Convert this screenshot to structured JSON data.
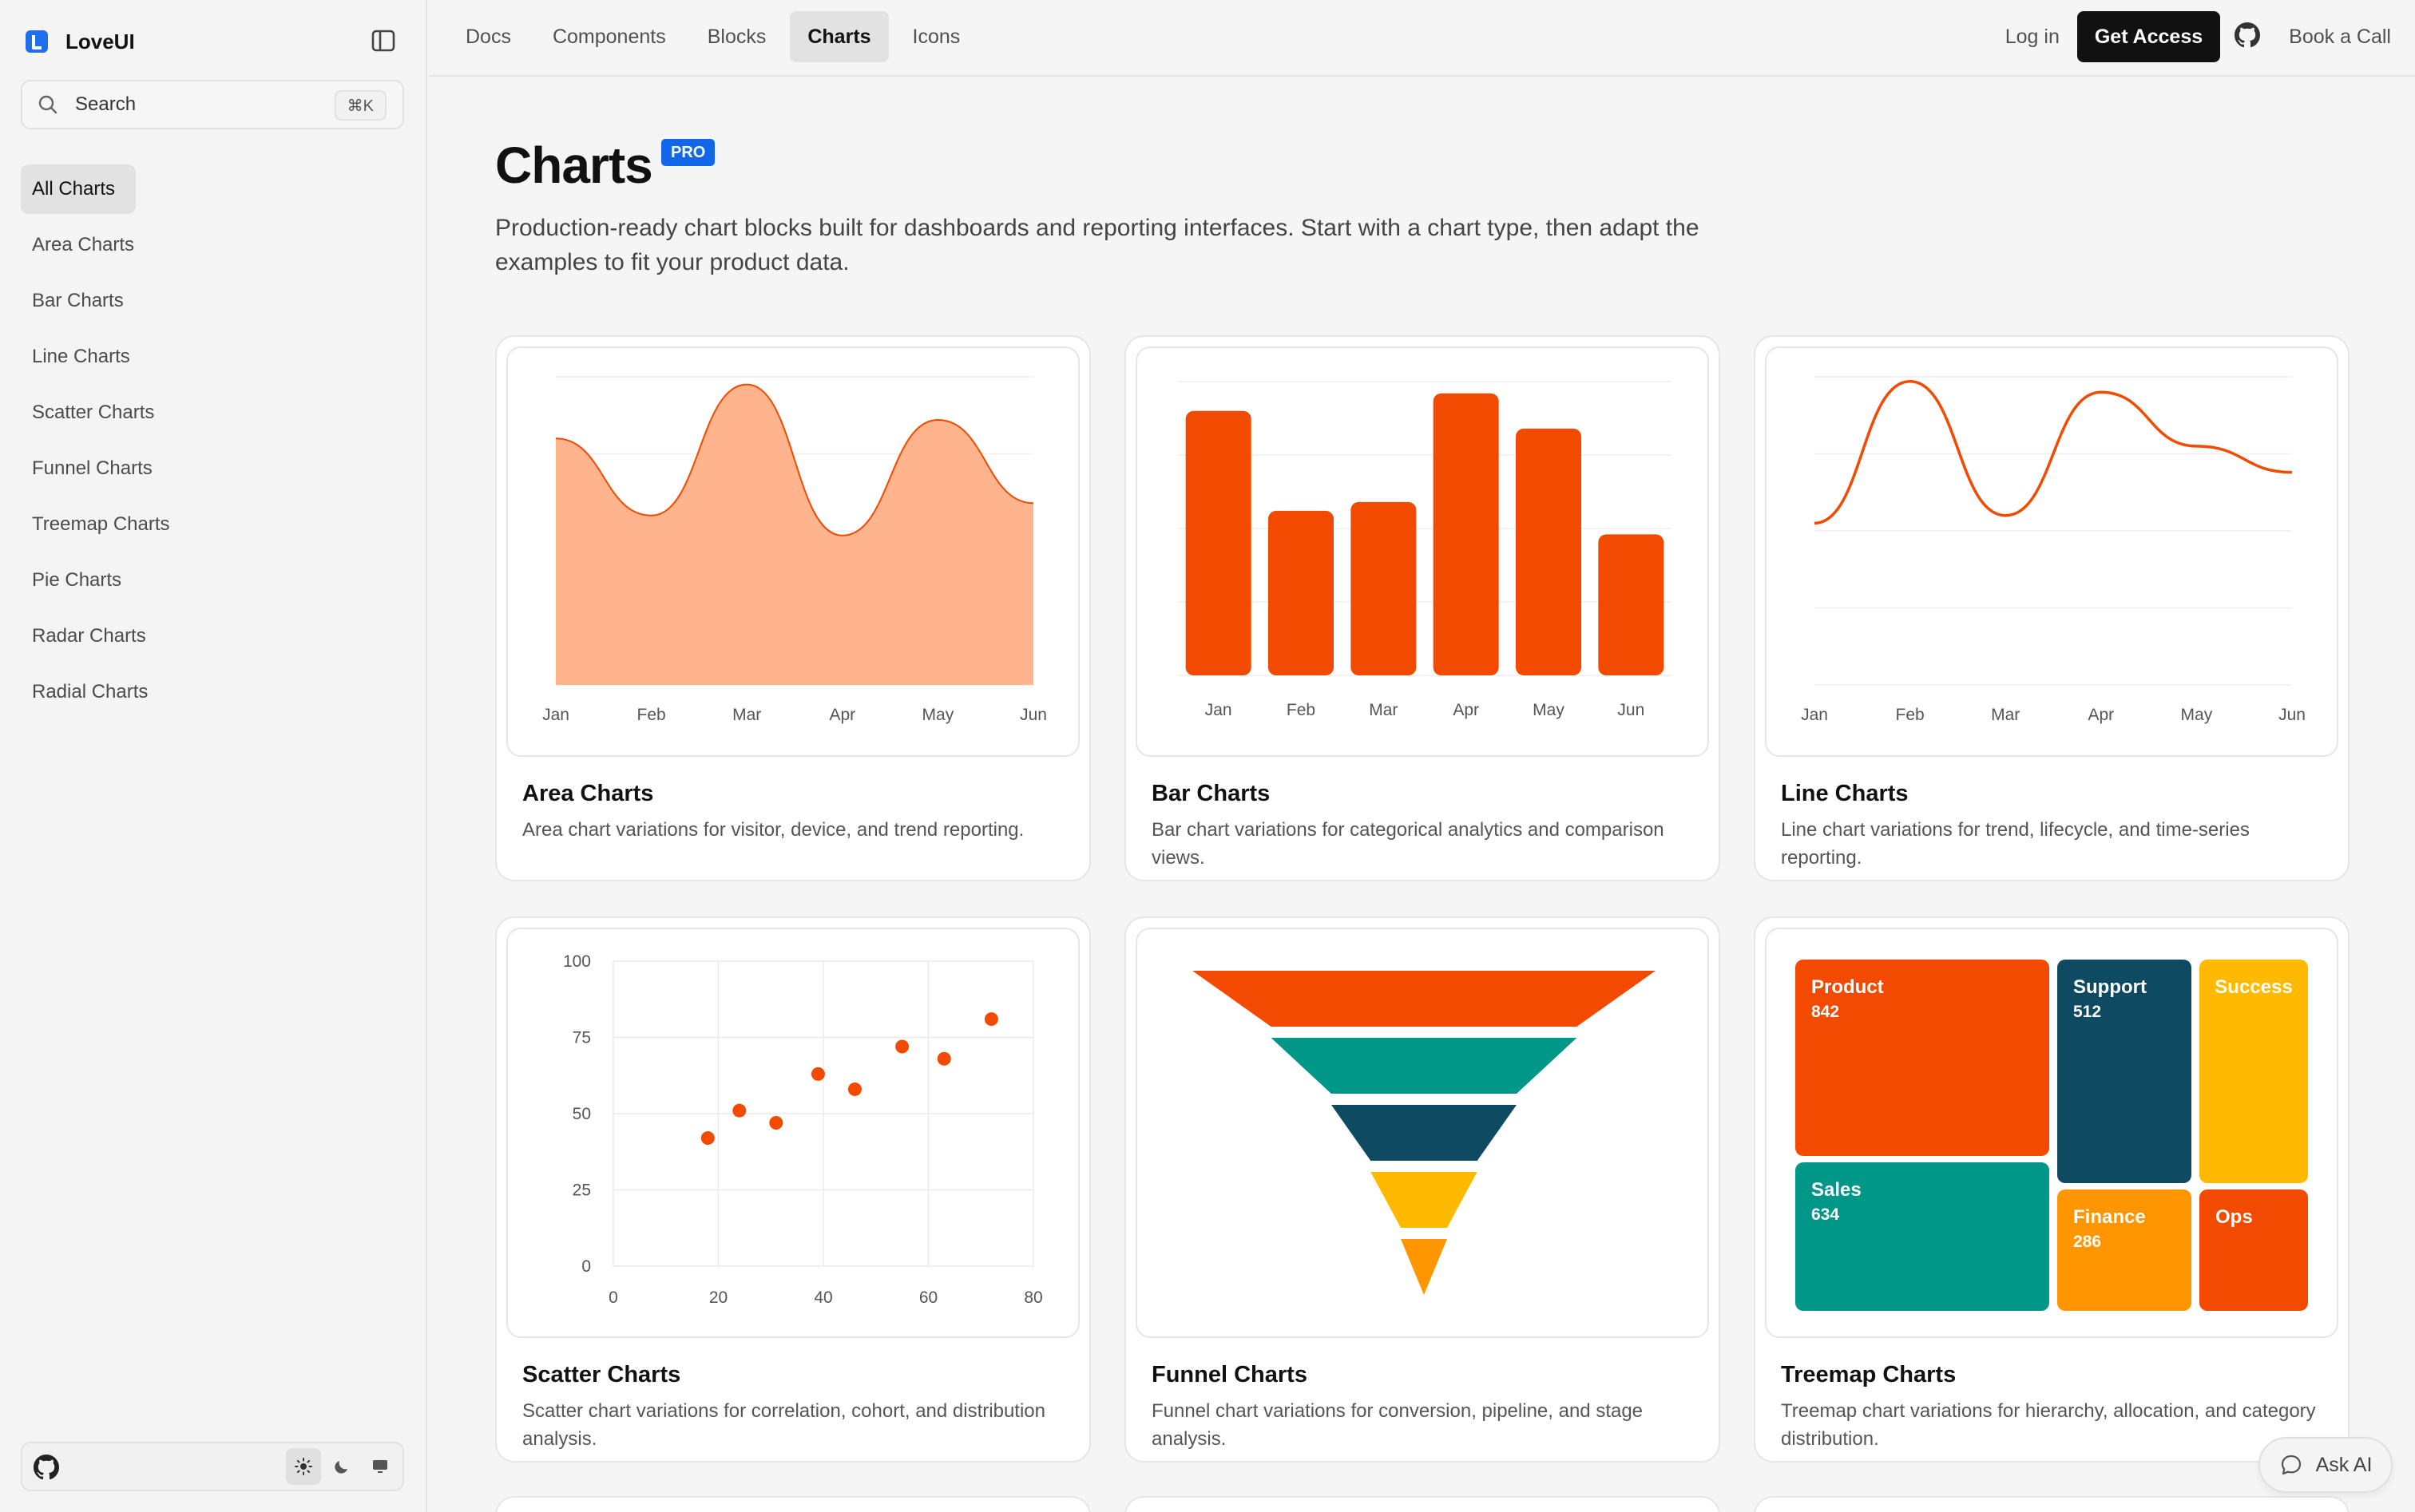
{
  "sidebar": {
    "brand": "LoveUI",
    "search": {
      "placeholder": "Search",
      "shortcut": "⌘K"
    },
    "items": [
      {
        "label": "All Charts",
        "active": true
      },
      {
        "label": "Area Charts"
      },
      {
        "label": "Bar Charts"
      },
      {
        "label": "Line Charts"
      },
      {
        "label": "Scatter Charts"
      },
      {
        "label": "Funnel Charts"
      },
      {
        "label": "Treemap Charts"
      },
      {
        "label": "Pie Charts"
      },
      {
        "label": "Radar Charts"
      },
      {
        "label": "Radial Charts"
      }
    ],
    "footer_icons": [
      "github-icon",
      "sun-icon",
      "moon-icon",
      "monitor-icon"
    ]
  },
  "topbar": {
    "links": [
      {
        "label": "Docs"
      },
      {
        "label": "Components"
      },
      {
        "label": "Blocks"
      },
      {
        "label": "Charts",
        "active": true
      },
      {
        "label": "Icons"
      }
    ],
    "login": "Log in",
    "cta": "Get Access",
    "book": "Book a Call"
  },
  "page": {
    "title": "Charts",
    "badge": "PRO",
    "intro": "Production-ready chart blocks built for dashboards and reporting interfaces. Start with a chart type, then adapt the examples to fit your product data."
  },
  "colors": {
    "accent": "#f24a00",
    "area_fill": "#ffb48d",
    "teal": "#009688",
    "navy": "#0f4a63",
    "amber": "#ffba00",
    "orange": "#ff9500",
    "brand_blue": "#1167e8"
  },
  "cards": [
    {
      "title": "Area Charts",
      "desc": "Area chart variations for visitor, device, and trend reporting."
    },
    {
      "title": "Bar Charts",
      "desc": "Bar chart variations for categorical analytics and comparison views."
    },
    {
      "title": "Line Charts",
      "desc": "Line chart variations for trend, lifecycle, and time-series reporting."
    },
    {
      "title": "Scatter Charts",
      "desc": "Scatter chart variations for correlation, cohort, and distribution analysis."
    },
    {
      "title": "Funnel Charts",
      "desc": "Funnel chart variations for conversion, pipeline, and stage analysis."
    },
    {
      "title": "Treemap Charts",
      "desc": "Treemap chart variations for hierarchy, allocation, and category distribution."
    }
  ],
  "ask_ai": "Ask AI",
  "chart_data": [
    {
      "type": "area",
      "categories": [
        "Jan",
        "Feb",
        "Mar",
        "Apr",
        "May",
        "Jun"
      ],
      "values": [
        160,
        110,
        195,
        97,
        172,
        118
      ],
      "ylim": [
        0,
        200
      ],
      "grid": true
    },
    {
      "type": "bar",
      "categories": [
        "Jan",
        "Feb",
        "Mar",
        "Apr",
        "May",
        "Jun"
      ],
      "values": [
        180,
        112,
        118,
        192,
        168,
        96
      ],
      "ylim": [
        0,
        200
      ],
      "grid": true
    },
    {
      "type": "line",
      "categories": [
        "Jan",
        "Feb",
        "Mar",
        "Apr",
        "May",
        "Jun"
      ],
      "values": [
        105,
        197,
        110,
        190,
        155,
        138
      ],
      "ylim": [
        0,
        200
      ],
      "grid": true
    },
    {
      "type": "scatter",
      "x": [
        18,
        24,
        31,
        39,
        46,
        55,
        63,
        72
      ],
      "y": [
        42,
        51,
        47,
        63,
        58,
        72,
        68,
        81
      ],
      "xlim": [
        0,
        80
      ],
      "ylim": [
        0,
        100
      ],
      "xticks": [
        "0",
        "20",
        "40",
        "60",
        "80"
      ],
      "yticks": [
        "0",
        "25",
        "50",
        "75",
        "100"
      ],
      "grid": true
    },
    {
      "type": "funnel",
      "stages": [
        {
          "value": 100,
          "color": "#f24a00"
        },
        {
          "value": 66,
          "color": "#009688"
        },
        {
          "value": 40,
          "color": "#0f4a63"
        },
        {
          "value": 23,
          "color": "#ffba00"
        },
        {
          "value": 10,
          "color": "#ff9500"
        }
      ]
    },
    {
      "type": "treemap",
      "cells": [
        {
          "label": "Product",
          "value": "842",
          "color": "#f24a00"
        },
        {
          "label": "Support",
          "value": "512",
          "color": "#0f4a63"
        },
        {
          "label": "Success",
          "value": "",
          "color": "#ffba00"
        },
        {
          "label": "Sales",
          "value": "634",
          "color": "#009688"
        },
        {
          "label": "Finance",
          "value": "286",
          "color": "#ff9500"
        },
        {
          "label": "Ops",
          "value": "",
          "color": "#f24a00"
        }
      ]
    }
  ]
}
